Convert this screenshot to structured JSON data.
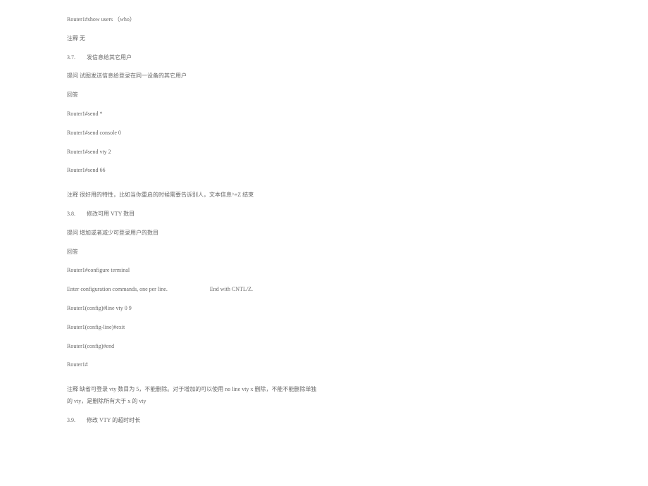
{
  "lines": {
    "l1": "Router1#show users （who）",
    "l2": "注释 无",
    "l3": "3.7.　　发信息给其它用户",
    "l4": "提问 试图发送信息给登录在同一设备的其它用户",
    "l5": "回答",
    "l6": "Router1#send *",
    "l7": "Router1#send console 0",
    "l8": "Router1#send vty 2",
    "l9": "Router1#send 66",
    "l10": "注释 很好用的特性，比如当你重启的时候需要告诉别人，文本信息^+Z 结束",
    "l11": "3.8.　　修改可用 VTY 数目",
    "l12": "提问 增加或者减少可登录用户的数目",
    "l13": "回答",
    "l14": "Router1#configure terminal",
    "l15a": "Enter configuration commands, one per line.",
    "l15b": "End with CNTL/Z.",
    "l16": "Router1(config)#line vty 0 9",
    "l17": "Router1(config-line)#exit",
    "l18": "Router1(config)#end",
    "l19": "Router1#",
    "l20": "注释 缺省可登录 vty 数目为 5，不能删除。对于增加的可以使用 no line vty x 删除，不能不能删除单独",
    "l21": "的 vty，是删除所有大于 x 的 vty",
    "l22": "3.9.　　修改 VTY 的超时时长"
  }
}
